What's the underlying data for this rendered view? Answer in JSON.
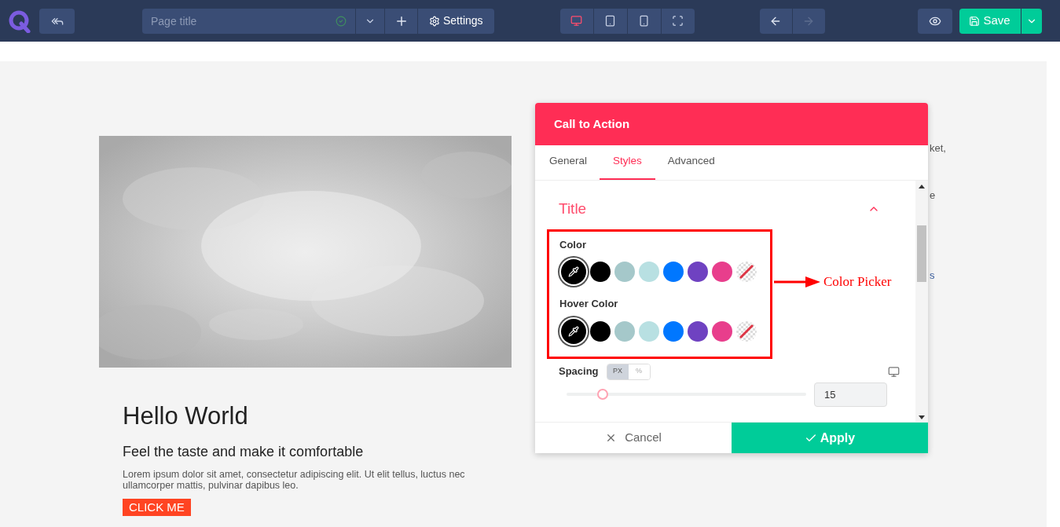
{
  "toolbar": {
    "page_title": {
      "placeholder": "Page title"
    },
    "settings_label": "Settings",
    "devices": [
      {
        "kind": "desktop",
        "selected": true
      },
      {
        "kind": "tablet",
        "selected": false
      },
      {
        "kind": "mobile",
        "selected": false
      },
      {
        "kind": "fullscreen",
        "selected": false
      }
    ],
    "history": [
      {
        "kind": "undo",
        "disabled": false
      },
      {
        "kind": "redo",
        "disabled": true
      }
    ],
    "save_label": "Save"
  },
  "page": {
    "heading": "Hello World",
    "subheading": "Feel the taste and make it comfortable",
    "body": "Lorem ipsum dolor sit amet, consectetur adipiscing elit. Ut elit tellus, luctus nec ullamcorper mattis, pulvinar dapibus leo.",
    "button": "CLICK ME",
    "hidden_fragments": [
      "ket,",
      "e",
      "s"
    ]
  },
  "dialog": {
    "title": "Call to Action",
    "tabs": [
      {
        "label": "General",
        "selected": false
      },
      {
        "label": "Styles",
        "selected": true
      },
      {
        "label": "Advanced",
        "selected": false
      }
    ],
    "section": {
      "title": "Title",
      "expanded": true
    },
    "color_groups": [
      {
        "label": "Color",
        "swatches": [
          {
            "kind": "picker",
            "color": "#000000",
            "selected": true
          },
          {
            "kind": "solid",
            "color": "#000000",
            "selected": false
          },
          {
            "kind": "solid",
            "color": "#a5c8ca",
            "selected": false
          },
          {
            "kind": "solid",
            "color": "#b8e0e2",
            "selected": false
          },
          {
            "kind": "solid",
            "color": "#0077ff",
            "selected": false
          },
          {
            "kind": "solid",
            "color": "#6f42c1",
            "selected": false
          },
          {
            "kind": "solid",
            "color": "#e83e8c",
            "selected": false
          },
          {
            "kind": "none",
            "selected": false
          }
        ]
      },
      {
        "label": "Hover Color",
        "swatches": [
          {
            "kind": "picker",
            "color": "#000000",
            "selected": true
          },
          {
            "kind": "solid",
            "color": "#000000",
            "selected": false
          },
          {
            "kind": "solid",
            "color": "#a5c8ca",
            "selected": false
          },
          {
            "kind": "solid",
            "color": "#b8e0e2",
            "selected": false
          },
          {
            "kind": "solid",
            "color": "#0077ff",
            "selected": false
          },
          {
            "kind": "solid",
            "color": "#6f42c1",
            "selected": false
          },
          {
            "kind": "solid",
            "color": "#e83e8c",
            "selected": false
          },
          {
            "kind": "none",
            "selected": false
          }
        ]
      }
    ],
    "spacing": {
      "label": "Spacing",
      "units": [
        {
          "label": "PX",
          "selected": true
        },
        {
          "label": "%",
          "selected": false
        }
      ],
      "level": 0.15,
      "value": "15"
    },
    "cancel_label": "Cancel",
    "apply_label": "Apply"
  },
  "annotation": {
    "label": "Color Picker"
  }
}
